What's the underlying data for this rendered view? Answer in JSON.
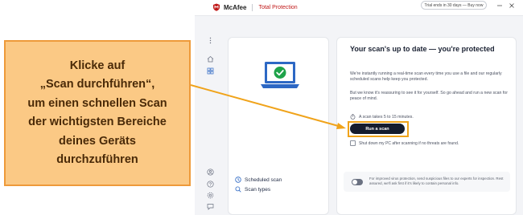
{
  "titlebar": {
    "brand_name": "McAfee",
    "product_name": "Total Protection",
    "trial_text": "Trial ends in 30 days — Buy now",
    "minimize_icon": "minimize-icon",
    "close_icon": "close-icon"
  },
  "sidebar": {
    "items": [
      {
        "icon": "more-dots-icon"
      },
      {
        "icon": "home-icon"
      },
      {
        "icon": "apps-grid-icon"
      },
      {
        "icon": "account-icon"
      },
      {
        "icon": "help-icon"
      },
      {
        "icon": "settings-icon"
      },
      {
        "icon": "feedback-icon"
      }
    ]
  },
  "left_card": {
    "status_icon": "laptop-check-icon",
    "links": [
      {
        "label": "Scheduled scan",
        "icon": "clock-icon"
      },
      {
        "label": "Scan types",
        "icon": "search-icon"
      }
    ]
  },
  "right_card": {
    "title": "Your scan's up to date — you're protected",
    "paragraph1": "We're instantly running a real-time scan every time you use a file and our regularly scheduled scans help keep you protected.",
    "paragraph2": "But we know it's reassuring to see it for yourself. So go ahead and run a new scan for peace of mind.",
    "scan_note": "A scan takes 5 to 15 minutes.",
    "run_button": "Run a scan",
    "shutdown_label": "Shut down my PC after scanning if no threats are found.",
    "option_text": "For improved virus protection, send suspicious files to our experts for inspection. Rest assured, we'll ask first if it's likely to contain personal info."
  },
  "callout": {
    "lines": [
      "Klicke auf",
      "„Scan durchführen“,",
      "um einen schnellen Scan",
      "der wichtigsten Bereiche",
      "deines Geräts",
      "durchzuführen"
    ]
  },
  "colors": {
    "brand_red": "#c01818",
    "callout_fill": "#fbc985",
    "callout_border": "#ee9a3a",
    "highlight": "#f0a31a",
    "success_green": "#1fa34a",
    "laptop_blue": "#2d68c4",
    "button_dark": "#141b2d"
  }
}
